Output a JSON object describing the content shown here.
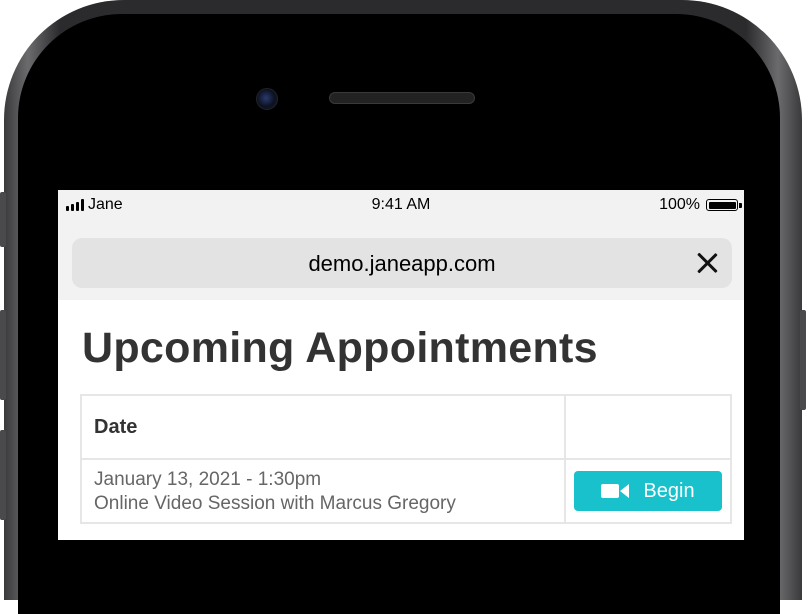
{
  "status_bar": {
    "carrier": "Jane",
    "time": "9:41 AM",
    "battery": "100%"
  },
  "browser": {
    "url": "demo.janeapp.com",
    "close_icon": "close-icon"
  },
  "page": {
    "title": "Upcoming Appointments"
  },
  "table": {
    "header": {
      "date": "Date",
      "action": ""
    },
    "appointments": [
      {
        "datetime": "January 13, 2021 - 1:30pm",
        "description": "Online Video Session with Marcus Gregory",
        "action_label": "Begin",
        "action_icon": "video-camera-icon"
      }
    ]
  },
  "colors": {
    "accent": "#18c1cc",
    "title": "#333333",
    "muted": "#666666"
  }
}
